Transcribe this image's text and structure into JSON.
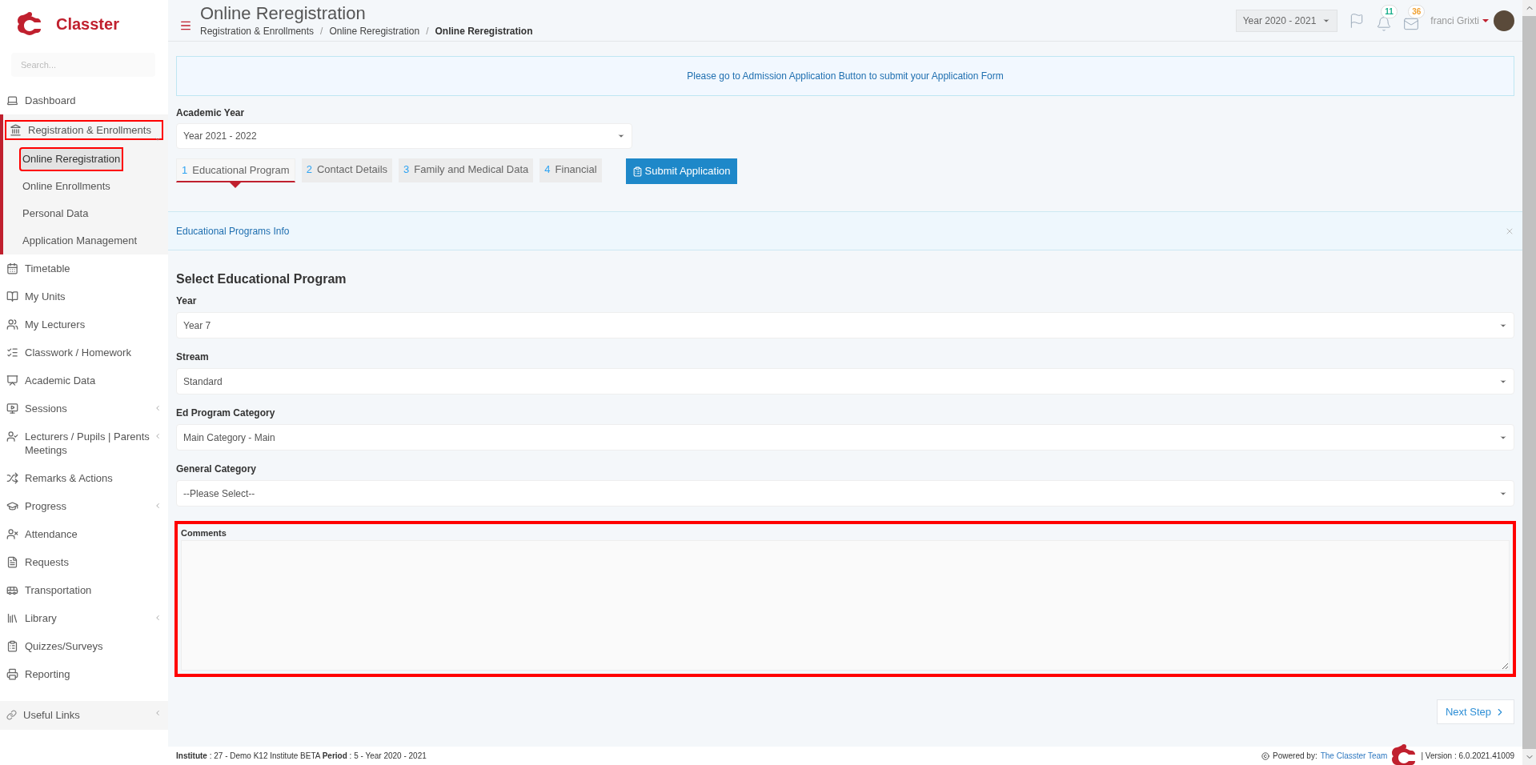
{
  "brand": {
    "name": "Classter"
  },
  "sidebar": {
    "search": {
      "placeholder": "Search..."
    },
    "items": [
      {
        "label": "Dashboard",
        "has_submenu": false,
        "annotated": false
      },
      {
        "label": "Registration & Enrollments",
        "has_submenu": true,
        "expanded": true,
        "annotated": true,
        "children": [
          {
            "label": "Online Reregistration",
            "selected": true,
            "annotated": true
          },
          {
            "label": "Online Enrollments",
            "selected": false,
            "annotated": false
          },
          {
            "label": "Personal Data",
            "selected": false,
            "annotated": false
          },
          {
            "label": "Application Management",
            "selected": false,
            "annotated": false
          }
        ]
      },
      {
        "label": "Timetable",
        "has_submenu": false,
        "annotated": false
      },
      {
        "label": "My Units",
        "has_submenu": false,
        "annotated": false
      },
      {
        "label": "My Lecturers",
        "has_submenu": false,
        "annotated": false
      },
      {
        "label": "Classwork / Homework",
        "has_submenu": false,
        "annotated": false
      },
      {
        "label": "Academic Data",
        "has_submenu": false,
        "annotated": false
      },
      {
        "label": "Sessions",
        "has_submenu": true,
        "annotated": false
      },
      {
        "label": "Lecturers / Pupils | Parents Meetings",
        "has_submenu": true,
        "annotated": false
      },
      {
        "label": "Remarks & Actions",
        "has_submenu": false,
        "annotated": false
      },
      {
        "label": "Progress",
        "has_submenu": true,
        "annotated": false
      },
      {
        "label": "Attendance",
        "has_submenu": false,
        "annotated": false
      },
      {
        "label": "Requests",
        "has_submenu": false,
        "annotated": false
      },
      {
        "label": "Transportation",
        "has_submenu": false,
        "annotated": false
      },
      {
        "label": "Library",
        "has_submenu": true,
        "annotated": false
      },
      {
        "label": "Quizzes/Surveys",
        "has_submenu": false,
        "annotated": false
      },
      {
        "label": "Reporting",
        "has_submenu": false,
        "annotated": false
      }
    ],
    "useful_links": {
      "label": "Useful Links",
      "has_submenu": true
    }
  },
  "header": {
    "title": "Online Reregistration",
    "breadcrumb_separator": "/",
    "breadcrumbs": [
      {
        "label": "Registration & Enrollments",
        "selected": false
      },
      {
        "label": "Online Reregistration",
        "selected": false
      },
      {
        "label": "Online Reregistration",
        "selected": true
      }
    ],
    "year_dropdown": "Year 2020 - 2021",
    "notifications": {
      "count": "11",
      "color": "#1aaf8b"
    },
    "messages": {
      "count": "36",
      "color": "#f0a030"
    },
    "user": "franci Grixti"
  },
  "notice": "Please go to Admission Application Button to submit your Application Form",
  "academic_year": {
    "label": "Academic Year",
    "value": "Year 2021 - 2022"
  },
  "steps": [
    {
      "number": "1",
      "label": "Educational Program",
      "selected": true
    },
    {
      "number": "2",
      "label": "Contact Details",
      "selected": false
    },
    {
      "number": "3",
      "label": "Family and Medical Data",
      "selected": false
    },
    {
      "number": "4",
      "label": "Financial",
      "selected": false
    }
  ],
  "submit_button": "Submit Application",
  "info_panel": {
    "title": "Educational Programs Info"
  },
  "section_title": "Select Educational Program",
  "fields": [
    {
      "label": "Year",
      "value": "Year 7"
    },
    {
      "label": "Stream",
      "value": "Standard"
    },
    {
      "label": "Ed Program Category",
      "value": "Main Category - Main"
    },
    {
      "label": "General Category",
      "value": "--Please Select--"
    }
  ],
  "comments": {
    "label": "Comments",
    "annotated": true
  },
  "next_button": "Next Step",
  "footer": {
    "info": "**Institute** : 27 - Demo K12 Institute BETA **Period** : 5 - Year 2020 - 2021",
    "powered_by": "Powered by:",
    "link": "The Classter Team",
    "version": "| Version : 6.0.2021.41009"
  }
}
